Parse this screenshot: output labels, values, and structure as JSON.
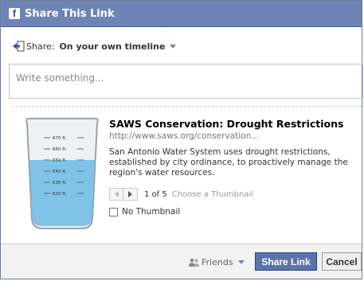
{
  "dialog": {
    "title": "Share This Link"
  },
  "share": {
    "label": "Share:",
    "target": "On your own timeline"
  },
  "composer": {
    "placeholder": "Write something..."
  },
  "link": {
    "title": "SAWS Conservation: Drought Restrictions",
    "url": "http://www.saws.org/conservation...",
    "description": "San Antonio Water System uses drought restrictions, established by city ordinance, to proactively manage the region's water resources.",
    "thumbnail": {
      "labels": [
        "670 ft.",
        "660 ft.",
        "650 ft.",
        "640 ft.",
        "630 ft.",
        "620 ft."
      ],
      "water_color": "#6bbbe6"
    },
    "pager": {
      "count": "1 of 5",
      "choose": "Choose a Thumbnail"
    },
    "no_thumbnail_label": "No Thumbnail",
    "no_thumbnail_checked": false
  },
  "footer": {
    "audience": "Friends",
    "share_button": "Share Link",
    "cancel_button": "Cancel"
  },
  "colors": {
    "titlebar": "#6d84b4",
    "primary_button": "#5b74a8"
  }
}
